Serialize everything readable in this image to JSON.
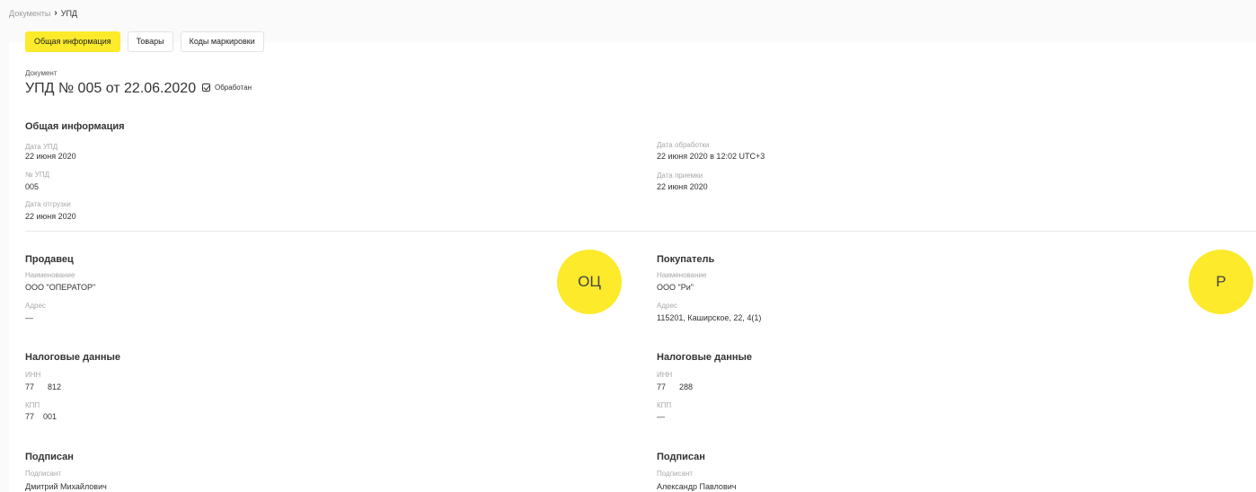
{
  "breadcrumb": {
    "parent": "Документы",
    "separator": "›",
    "current": "УПД"
  },
  "tabs": [
    {
      "label": "Общая информация",
      "active": true
    },
    {
      "label": "Товары",
      "active": false
    },
    {
      "label": "Коды маркировки",
      "active": false
    }
  ],
  "document": {
    "label": "Документ",
    "title": "УПД № 005 от 22.06.2020",
    "status": "Обработан",
    "status_checked": true
  },
  "general": {
    "title": "Общая информация",
    "upd_date_label": "Дата УПД",
    "upd_date": "22 июня 2020",
    "upd_number_label": "№ УПД",
    "upd_number": "005",
    "shipment_date_label": "Дата отгрузки",
    "shipment_date": "22 июня 2020",
    "processing_date_label": "Дата обработки",
    "processing_date": "22 июня 2020 в 12:02 UTC+3",
    "acceptance_date_label": "Дата приемки",
    "acceptance_date": "22 июня 2020"
  },
  "seller": {
    "title": "Продавец",
    "name_label": "Наименование",
    "name": "ООО \"ОПЕРАТОР\"",
    "address_label": "Адрес",
    "address": "—",
    "avatar_initials": "ОЦ",
    "tax_title": "Налоговые данные",
    "inn_label": "ИНН",
    "inn": "77      812",
    "kpp_label": "КПП",
    "kpp": "77    001",
    "signed_title": "Подписан",
    "signer_label": "Подписант",
    "signer": "Дмитрий Михайлович"
  },
  "buyer": {
    "title": "Покупатель",
    "name_label": "Наименование",
    "name": "ООО \"Ри\"",
    "address_label": "Адрес",
    "address": "115201, Каширское, 22, 4(1)",
    "avatar_initials": "Р",
    "tax_title": "Налоговые данные",
    "inn_label": "ИНН",
    "inn": "77      288",
    "kpp_label": "КПП",
    "kpp": "—",
    "signed_title": "Подписан",
    "signer_label": "Подписант",
    "signer": "Александр Павлович"
  },
  "colors": {
    "accent": "#fcea2b",
    "label": "#a8a8a8",
    "text": "#333333"
  }
}
